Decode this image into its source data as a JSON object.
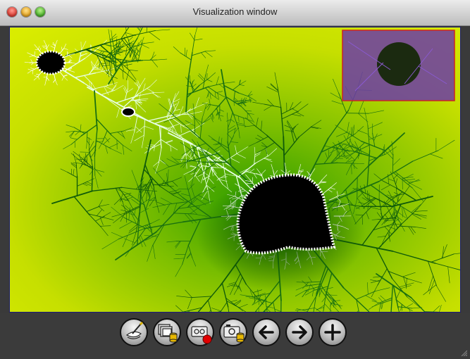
{
  "window": {
    "title": "Visualization window"
  },
  "toolbar": {
    "buttons": [
      {
        "name": "brush-palette-button",
        "icon": "palette-brush-icon"
      },
      {
        "name": "save-stack-button",
        "icon": "stack-database-icon"
      },
      {
        "name": "record-button",
        "icon": "record-icon"
      },
      {
        "name": "snapshot-button",
        "icon": "camera-icon"
      },
      {
        "name": "back-button",
        "icon": "arrow-left-icon"
      },
      {
        "name": "forward-button",
        "icon": "arrow-right-icon"
      },
      {
        "name": "zoom-in-button",
        "icon": "plus-icon"
      }
    ]
  },
  "colors": {
    "fractal_inner": "#000000",
    "fractal_edge": "#ffffff",
    "field_far": "#d8ea00",
    "field_near": "#1e8a00",
    "overview_tint": "#6b3aa8"
  }
}
